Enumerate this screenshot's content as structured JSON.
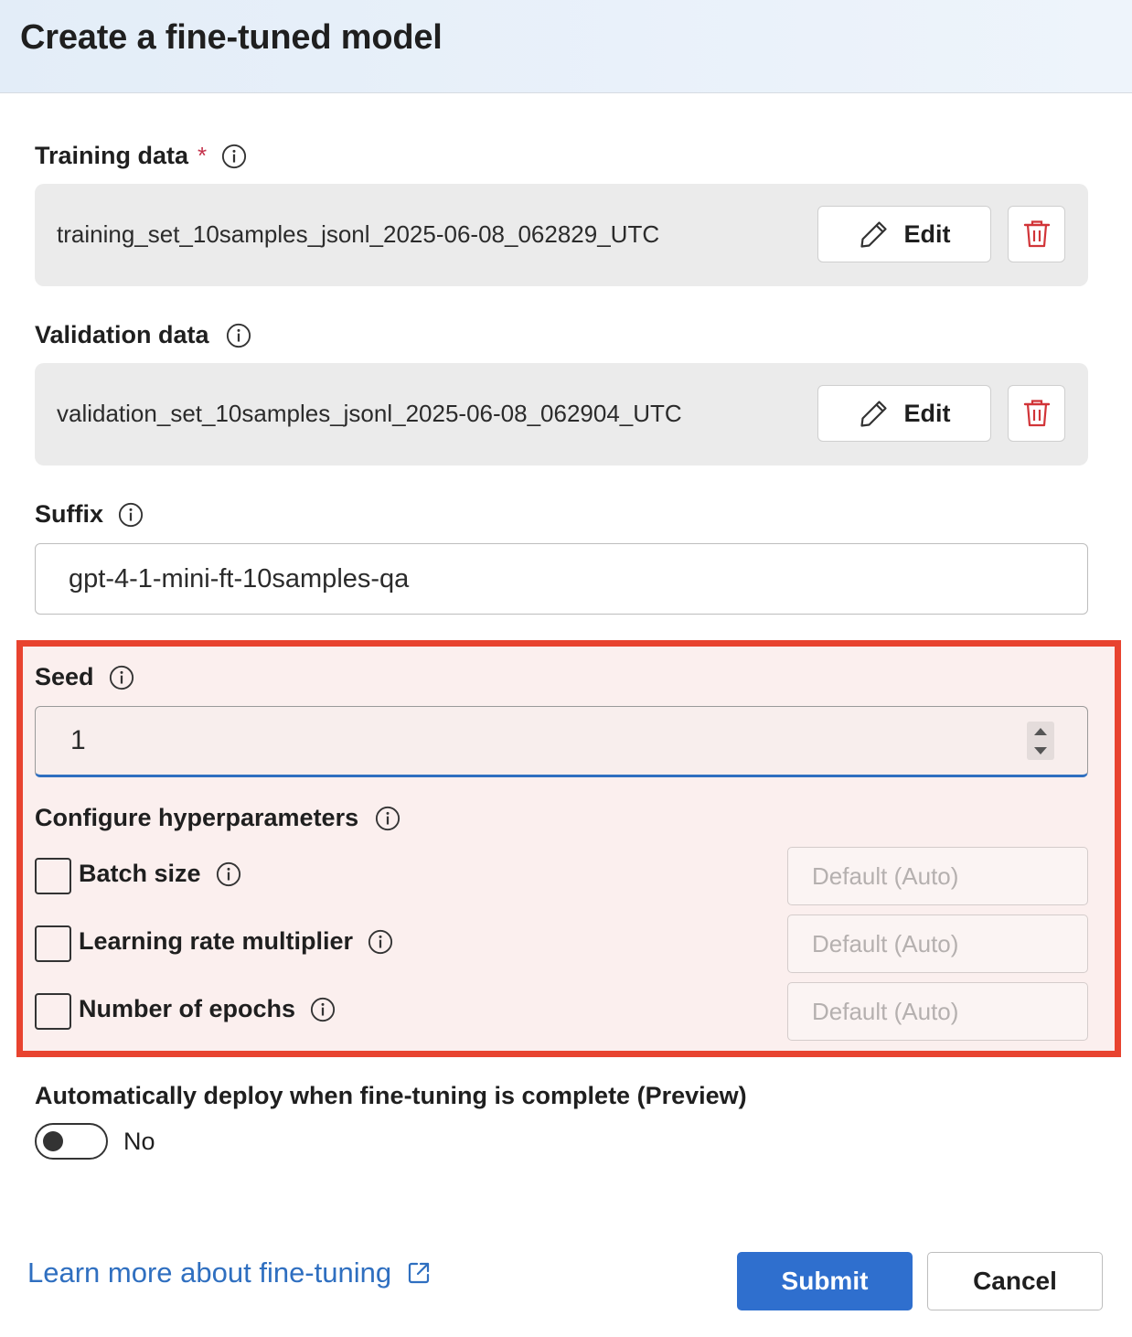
{
  "header": {
    "title": "Create a fine-tuned model"
  },
  "training_data": {
    "label": "Training data",
    "required_mark": "*",
    "file_name": "training_set_10samples_jsonl_2025-06-08_062829_UTC",
    "edit_label": "Edit"
  },
  "validation_data": {
    "label": "Validation data",
    "file_name": "validation_set_10samples_jsonl_2025-06-08_062904_UTC",
    "edit_label": "Edit"
  },
  "suffix": {
    "label": "Suffix",
    "value": "gpt-4-1-mini-ft-10samples-qa"
  },
  "seed": {
    "label": "Seed",
    "value": "1"
  },
  "hyperparameters": {
    "label": "Configure hyperparameters",
    "items": [
      {
        "label": "Batch size",
        "placeholder": "Default (Auto)",
        "checked": false
      },
      {
        "label": "Learning rate multiplier",
        "placeholder": "Default (Auto)",
        "checked": false
      },
      {
        "label": "Number of epochs",
        "placeholder": "Default (Auto)",
        "checked": false
      }
    ]
  },
  "auto_deploy": {
    "label": "Automatically deploy when fine-tuning is complete (Preview)",
    "state_text": "No",
    "on": false
  },
  "footer": {
    "learn_more": "Learn more about fine-tuning",
    "submit_label": "Submit",
    "cancel_label": "Cancel"
  },
  "colors": {
    "accent": "#2f6fce",
    "highlight_border": "#e8432f",
    "delete_icon": "#d13438",
    "link": "#2f6fc0"
  },
  "icons": {
    "info": "info-icon",
    "edit": "pencil-icon",
    "delete": "trash-icon",
    "external": "external-link-icon"
  }
}
